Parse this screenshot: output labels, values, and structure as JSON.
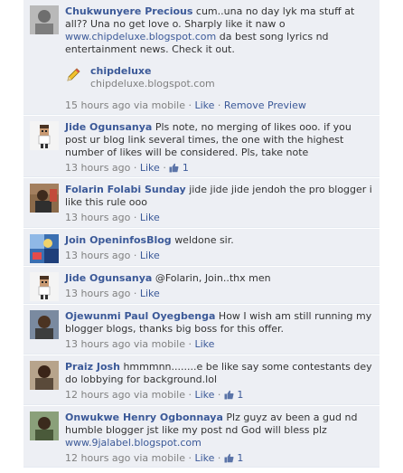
{
  "comments": [
    {
      "author": "Chukwunyere Precious",
      "text_before": "cum..una no day lyk ma stuff at all?? Una no get love o. Sharply like it naw o ",
      "link_text": "www.chipdeluxe.blogspot.com",
      "text_after": " da best song lyrics nd entertainment news. Check it out.",
      "preview_title": "chipdeluxe",
      "preview_url": "chipdeluxe.blogspot.com",
      "time": "15 hours ago via mobile",
      "actions": [
        "Like",
        "Remove Preview"
      ],
      "likes": ""
    },
    {
      "author": "Jide Ogunsanya",
      "text": "Pls note, no merging of likes ooo. if you post ur blog link several times, the one with the highest number of likes will be considered. Pls, take note",
      "time": "13 hours ago",
      "actions": [
        "Like"
      ],
      "likes": "1"
    },
    {
      "author": "Folarin Folabi Sunday",
      "text": "jide jide jide jendoh the pro blogger i like this rule ooo",
      "time": "13 hours ago",
      "actions": [
        "Like"
      ],
      "likes": ""
    },
    {
      "author": "Join OpeninfosBlog",
      "text": "weldone sir.",
      "time": "13 hours ago",
      "actions": [
        "Like"
      ],
      "likes": ""
    },
    {
      "author": "Jide Ogunsanya",
      "text": "@Folarin, Join..thx men",
      "time": "13 hours ago",
      "actions": [
        "Like"
      ],
      "likes": ""
    },
    {
      "author": "Ojewunmi Paul Oyegbenga",
      "text": "How I wish am still running my blogger blogs, thanks big boss for this offer.",
      "time": "13 hours ago via mobile",
      "actions": [
        "Like"
      ],
      "likes": ""
    },
    {
      "author": "Praiz Josh",
      "text": "hmmmnn........e be like say some contestants dey do lobbying for background.lol",
      "time": "12 hours ago via mobile",
      "actions": [
        "Like"
      ],
      "likes": "1"
    },
    {
      "author": "Onwukwe Henry Ogbonnaya",
      "text": "Plz guyz av been a gud nd humble blogger jst like my post nd God will bless plz",
      "link_text": "www.9jalabel.blogspot.com",
      "time": "12 hours ago via mobile",
      "actions": [
        "Like"
      ],
      "likes": "1"
    }
  ],
  "colors": {
    "link": "#3b5998",
    "comment_bg": "#edeff4",
    "meta": "#808080"
  }
}
